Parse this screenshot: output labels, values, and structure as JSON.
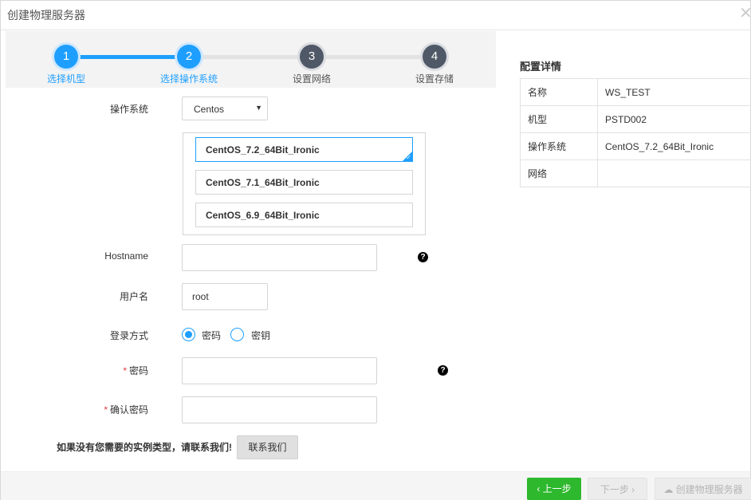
{
  "window": {
    "title": "创建物理服务器"
  },
  "wizard": {
    "steps": [
      {
        "number": "1",
        "label": "选择机型",
        "state": "done"
      },
      {
        "number": "2",
        "label": "选择操作系统",
        "state": "active"
      },
      {
        "number": "3",
        "label": "设置网络",
        "state": "todo"
      },
      {
        "number": "4",
        "label": "设置存储",
        "state": "todo"
      }
    ]
  },
  "form": {
    "os_label": "操作系统",
    "os_select_value": "Centos",
    "images": [
      {
        "name": "CentOS_7.2_64Bit_Ironic",
        "selected": true
      },
      {
        "name": "CentOS_7.1_64Bit_Ironic",
        "selected": false
      },
      {
        "name": "CentOS_6.9_64Bit_Ironic",
        "selected": false
      }
    ],
    "hostname_label": "Hostname",
    "hostname_value": "",
    "username_label": "用户名",
    "username_value": "root",
    "login_label": "登录方式",
    "login_options": [
      {
        "label": "密码",
        "checked": true
      },
      {
        "label": "密钥",
        "checked": false
      }
    ],
    "password_required_mark": "*",
    "password_label": "密码",
    "password_value": "",
    "confirm_required_mark": "*",
    "confirm_label": "确认密码",
    "confirm_value": "",
    "help_glyph": "?"
  },
  "contact": {
    "note": "如果没有您需要的实例类型，请联系我们!",
    "button_label": "联系我们"
  },
  "summary": {
    "title": "配置详情",
    "rows": [
      {
        "key": "名称",
        "value": "WS_TEST"
      },
      {
        "key": "机型",
        "value": "PSTD002"
      },
      {
        "key": "操作系统",
        "value": "CentOS_7.2_64Bit_Ironic"
      },
      {
        "key": "网络",
        "value": ""
      }
    ]
  },
  "footer": {
    "prev_label": "上一步",
    "next_label": "下一步",
    "create_label": "创建物理服务器"
  },
  "colors": {
    "accent": "#1e9fff",
    "success": "#2eb82e",
    "pending_step": "#4f5866",
    "required": "#e4393c"
  },
  "icons": {
    "close": "close-icon",
    "dropdown": "caret-down-icon",
    "help": "question-circle-icon",
    "selected_check": "check-icon",
    "prev": "chevron-left-icon",
    "next": "chevron-right-icon",
    "create": "cloud-upload-icon"
  }
}
